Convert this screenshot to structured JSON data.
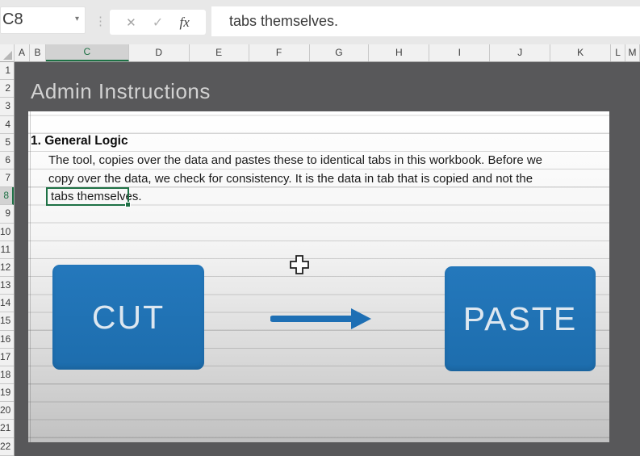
{
  "formula_bar": {
    "cell_reference": "C8",
    "formula_text": "tabs themselves.",
    "dropdown_icon": "▾",
    "dots_icon": "⋮",
    "cancel_icon": "✕",
    "enter_icon": "✓",
    "function_icon": "fx"
  },
  "grid": {
    "column_headers": [
      "A",
      "B",
      "C",
      "D",
      "E",
      "F",
      "G",
      "H",
      "I",
      "J",
      "K",
      "L",
      "M"
    ],
    "selected_column": "C",
    "row_headers": [
      "1",
      "2",
      "3",
      "4",
      "5",
      "6",
      "7",
      "8",
      "9",
      "10",
      "11",
      "12",
      "13",
      "14",
      "15",
      "16",
      "17",
      "18",
      "19",
      "20",
      "21",
      "22"
    ],
    "selected_row": "8",
    "selected_cell": "C8"
  },
  "sheet_content": {
    "title": "Admin Instructions",
    "section_heading": "1. General Logic",
    "body_lines": [
      "The tool, copies over the data and pastes these to identical tabs in this workbook. Before we",
      "copy over the data, we check for consistency. It is the data in tab that is copied and not the",
      "tabs themselves."
    ],
    "cut_button_label": "CUT",
    "paste_button_label": "PASTE"
  },
  "colors": {
    "button_blue": "#1F71B4",
    "selection_green": "#1E7145",
    "dark_background": "#58585A",
    "panel_white": "#FFFFFF"
  }
}
